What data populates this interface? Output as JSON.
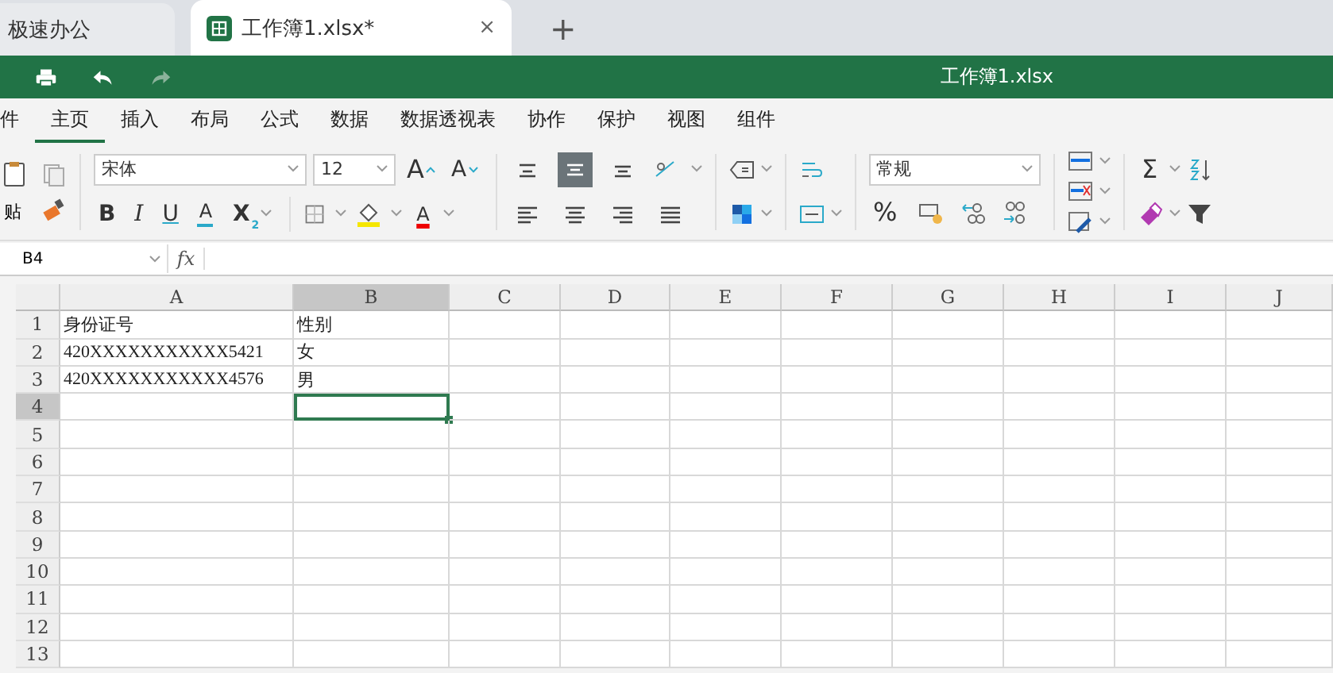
{
  "tabs": [
    {
      "label": "极速办公",
      "selected": false
    },
    {
      "label": "工作簿1.xlsx*",
      "selected": true,
      "close": "×"
    }
  ],
  "new_tab": "+",
  "title_bar": {
    "title": "工作簿1.xlsx"
  },
  "menu": [
    {
      "label": "件",
      "selected": false
    },
    {
      "label": "主页",
      "selected": true
    },
    {
      "label": "插入",
      "selected": false
    },
    {
      "label": "布局",
      "selected": false
    },
    {
      "label": "公式",
      "selected": false
    },
    {
      "label": "数据",
      "selected": false
    },
    {
      "label": "数据透视表",
      "selected": false
    },
    {
      "label": "协作",
      "selected": false
    },
    {
      "label": "保护",
      "selected": false
    },
    {
      "label": "视图",
      "selected": false
    },
    {
      "label": "组件",
      "selected": false
    }
  ],
  "ribbon": {
    "paste_label": "贴",
    "font": "宋体",
    "font_size": "12",
    "grow_font": "A",
    "shrink_font": "A",
    "bold": "B",
    "italic": "I",
    "underline": "U",
    "strike": "A",
    "subscript": "X",
    "subscript_index": "2",
    "font_color": "A",
    "align_top": {
      "selected": false
    },
    "align_middle": {
      "selected": true
    },
    "align_bottom": {
      "selected": false
    },
    "number_format": "常规",
    "percent": "%",
    "sum": "Σ"
  },
  "formula_bar": {
    "cell_ref": "B4",
    "fx": "fx"
  },
  "sheet": {
    "columns": [
      {
        "label": "A",
        "selected": false
      },
      {
        "label": "B",
        "selected": true
      },
      {
        "label": "C",
        "selected": false
      },
      {
        "label": "D",
        "selected": false
      },
      {
        "label": "E",
        "selected": false
      },
      {
        "label": "F",
        "selected": false
      },
      {
        "label": "G",
        "selected": false
      },
      {
        "label": "H",
        "selected": false
      },
      {
        "label": "I",
        "selected": false
      },
      {
        "label": "J",
        "selected": false
      }
    ],
    "rows": [
      {
        "label": "1",
        "selected": false,
        "cells": [
          {
            "text": "身份证号",
            "selected": false
          },
          {
            "text": "性别",
            "selected": false
          }
        ]
      },
      {
        "label": "2",
        "selected": false,
        "cells": [
          {
            "text": "420XXXXXXXXXXX5421",
            "selected": false
          },
          {
            "text": "女",
            "selected": false
          }
        ]
      },
      {
        "label": "3",
        "selected": false,
        "cells": [
          {
            "text": "420XXXXXXXXXXX4576",
            "selected": false
          },
          {
            "text": "男",
            "selected": false
          }
        ]
      },
      {
        "label": "4",
        "selected": true,
        "cells": [
          {
            "selected": false
          },
          {
            "selected": true
          }
        ]
      },
      {
        "label": "5",
        "selected": false,
        "cells": []
      },
      {
        "label": "6",
        "selected": false,
        "cells": []
      },
      {
        "label": "7",
        "selected": false,
        "cells": []
      },
      {
        "label": "8",
        "selected": false,
        "cells": []
      },
      {
        "label": "9",
        "selected": false,
        "cells": []
      },
      {
        "label": "10",
        "selected": false,
        "cells": []
      },
      {
        "label": "11",
        "selected": false,
        "cells": []
      },
      {
        "label": "12",
        "selected": false,
        "cells": []
      },
      {
        "label": "13",
        "selected": false,
        "cells": []
      }
    ]
  }
}
